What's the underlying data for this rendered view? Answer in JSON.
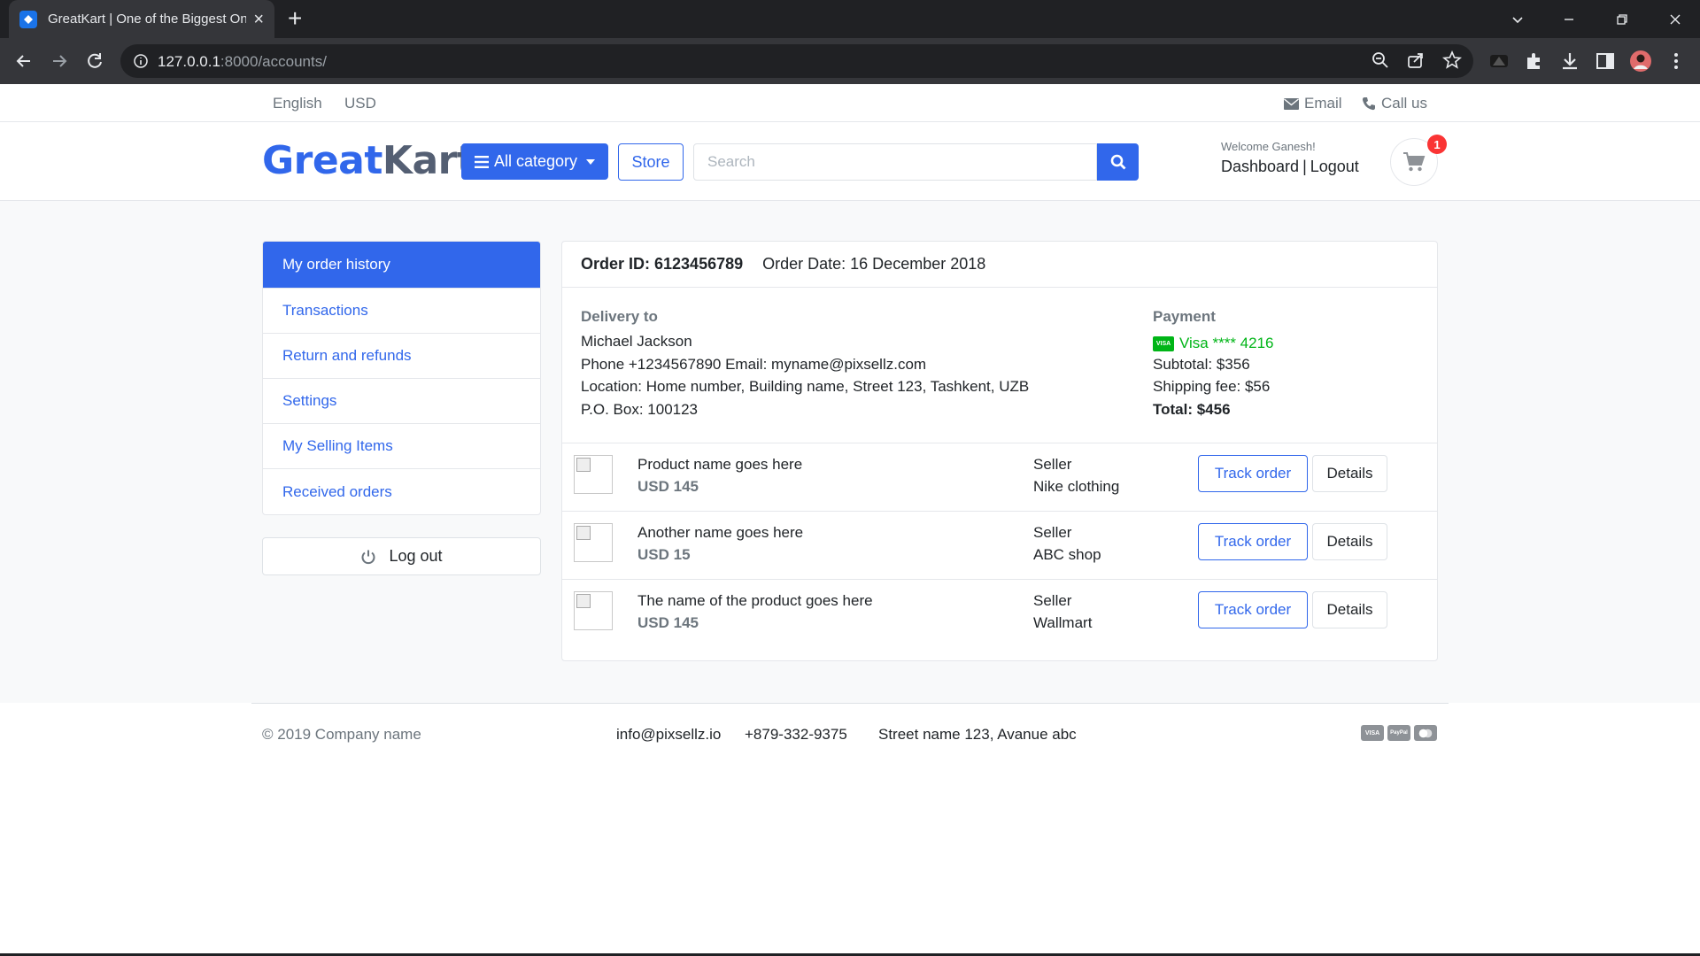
{
  "browser": {
    "tab_title": "GreatKart | One of the Biggest Online Shopping Platform",
    "url_host": "127.0.0.1",
    "url_path": ":8000/accounts/"
  },
  "topbar": {
    "language": "English",
    "currency": "USD",
    "email_label": "Email",
    "call_label": "Call us"
  },
  "header": {
    "logo_part1": "Great",
    "logo_part2": "Kart",
    "category_label": "All category",
    "store_label": "Store",
    "search_placeholder": "Search",
    "welcome": "Welcome Ganesh!",
    "dashboard_label": "Dashboard",
    "logout_label": "Logout",
    "cart_count": "1"
  },
  "sidebar": {
    "items": [
      {
        "label": "My order history",
        "active": true
      },
      {
        "label": "Transactions"
      },
      {
        "label": "Return and refunds"
      },
      {
        "label": "Settings"
      },
      {
        "label": "My Selling Items"
      },
      {
        "label": "Received orders"
      }
    ],
    "logout_label": "Log out"
  },
  "order": {
    "id_label": "Order ID: 6123456789",
    "date_label": "Order Date: 16 December 2018",
    "delivery_title": "Delivery to",
    "name": "Michael Jackson",
    "contact": "Phone +1234567890 Email: myname@pixsellz.com",
    "location": "Location: Home number, Building name, Street 123, Tashkent, UZB",
    "po_box": "P.O. Box: 100123",
    "payment_title": "Payment",
    "card": "Visa **** 4216",
    "card_badge": "VISA",
    "subtotal": "Subtotal: $356",
    "shipping": "Shipping fee: $56",
    "total": "Total: $456",
    "items": [
      {
        "name": "Product name goes here",
        "price": "USD 145",
        "seller_label": "Seller",
        "seller": "Nike clothing",
        "track": "Track order",
        "details": "Details"
      },
      {
        "name": "Another name goes here",
        "price": "USD 15",
        "seller_label": "Seller",
        "seller": "ABC shop",
        "track": "Track order",
        "details": "Details"
      },
      {
        "name": "The name of the product goes here",
        "price": "USD 145",
        "seller_label": "Seller",
        "seller": "Wallmart",
        "track": "Track order",
        "details": "Details"
      }
    ]
  },
  "footer": {
    "copyright": "© 2019 Company name",
    "email": "info@pixsellz.io",
    "phone": "+879-332-9375",
    "address": "Street name 123, Avanue abc",
    "pay_visa": "VISA",
    "pay_paypal": "PayPal"
  },
  "colors": {
    "primary": "#3167eb",
    "success": "#00b517",
    "danger": "#fa3434"
  }
}
